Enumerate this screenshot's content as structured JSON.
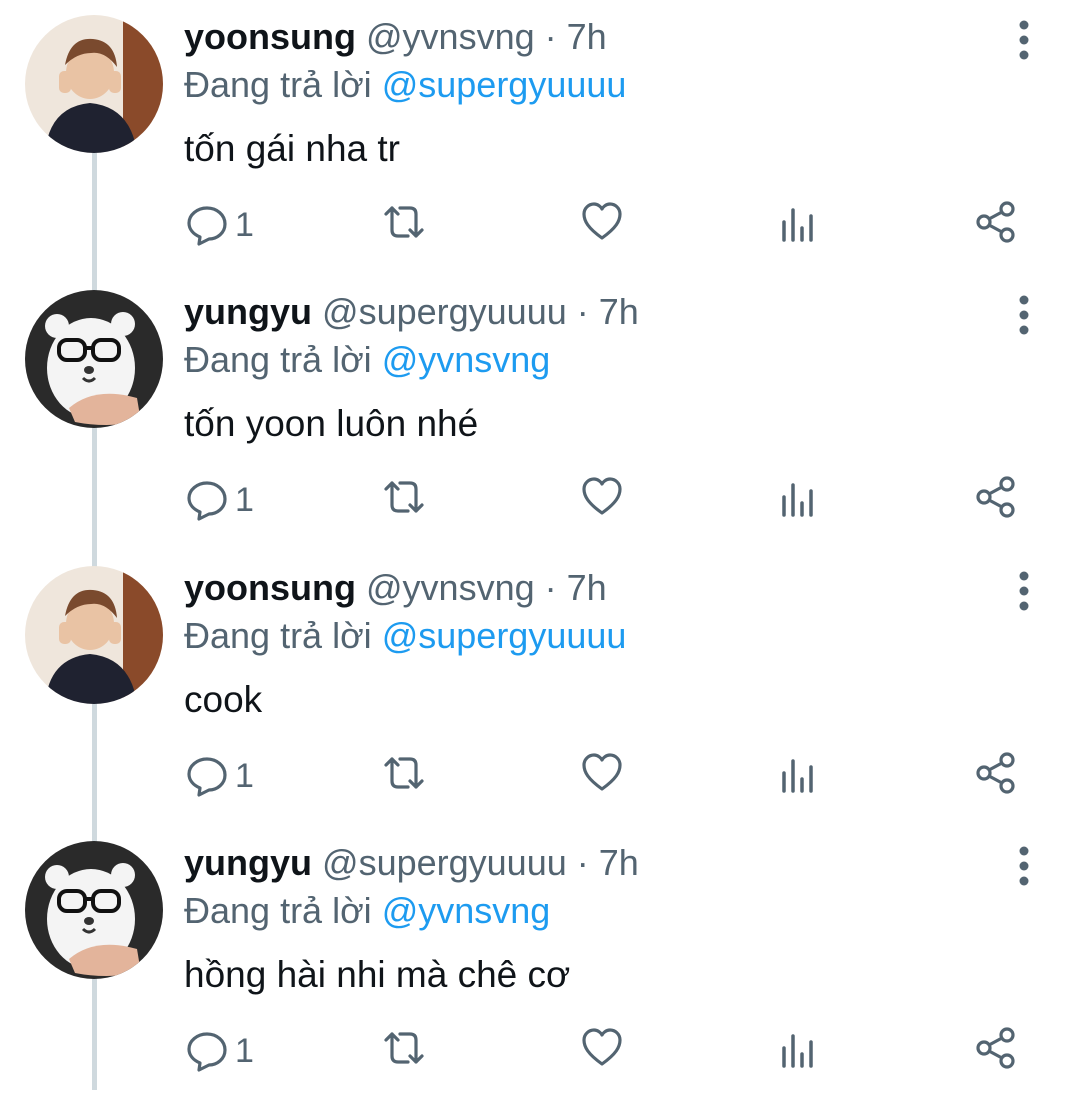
{
  "tweets": [
    {
      "display_name": "yoonsung",
      "handle": "@yvnsvng",
      "time": "· 7h",
      "reply_prefix": "Đang trả lời",
      "reply_to": "@supergyuuuu",
      "text": "tốn gái nha tr",
      "reply_count": "1",
      "avatar": "yoonsung-avatar"
    },
    {
      "display_name": "yungyu",
      "handle": "@supergyuuuu",
      "time": "· 7h",
      "reply_prefix": "Đang trả lời",
      "reply_to": "@yvnsvng",
      "text": "tốn yoon luôn nhé",
      "reply_count": "1",
      "avatar": "yungyu-avatar"
    },
    {
      "display_name": "yoonsung",
      "handle": "@yvnsvng",
      "time": "· 7h",
      "reply_prefix": "Đang trả lời",
      "reply_to": "@supergyuuuu",
      "text": "cook",
      "reply_count": "1",
      "avatar": "yoonsung-avatar"
    },
    {
      "display_name": "yungyu",
      "handle": "@supergyuuuu",
      "time": "· 7h",
      "reply_prefix": "Đang trả lời",
      "reply_to": "@yvnsvng",
      "text": "hồng hài nhi mà chê cơ",
      "reply_count": "1",
      "avatar": "yungyu-avatar"
    }
  ],
  "icons": {
    "reply": "reply-icon",
    "retweet": "retweet-icon",
    "like": "heart-icon",
    "stats": "stats-icon",
    "share": "share-icon",
    "more": "more-vertical-icon"
  },
  "colors": {
    "text": "#0f1419",
    "secondary": "#536471",
    "mention": "#1d9bf0",
    "thread_line": "#cfd9de"
  }
}
